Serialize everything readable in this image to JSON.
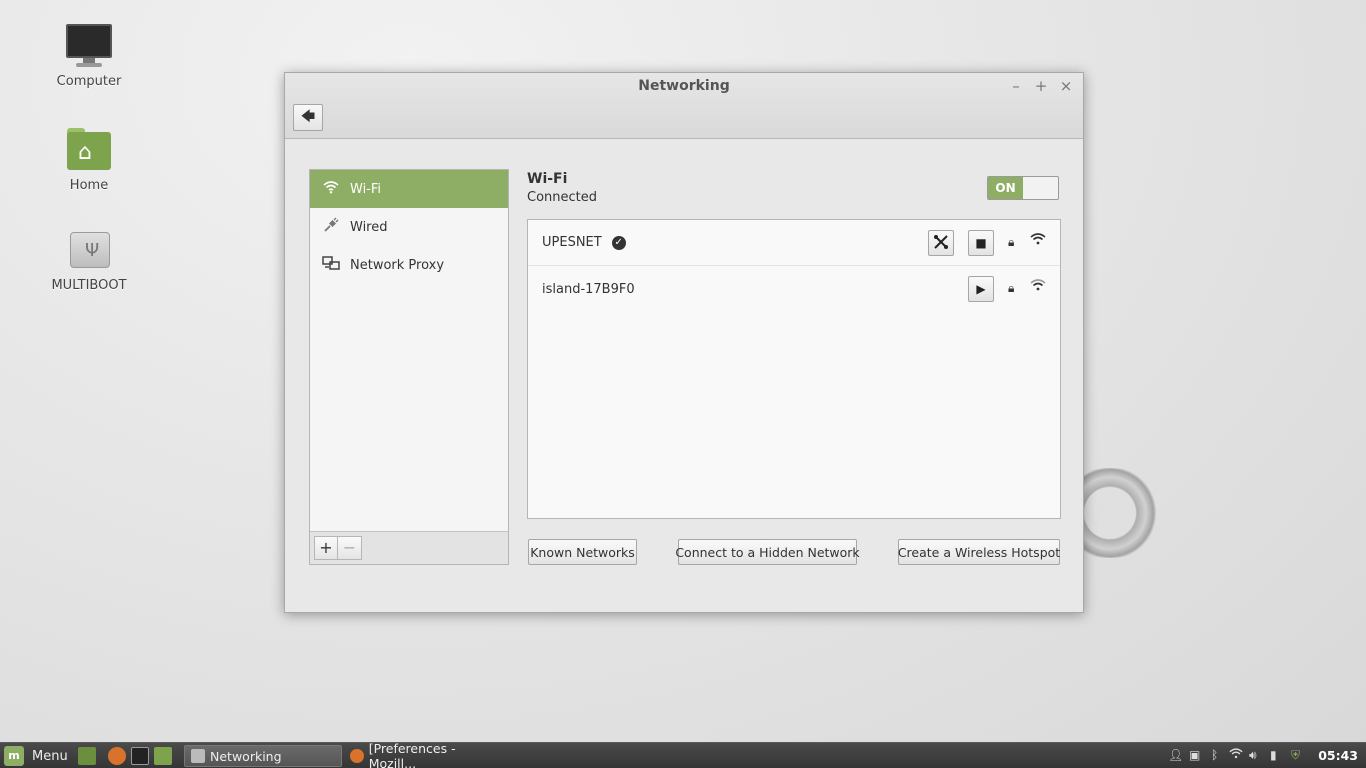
{
  "desktop": {
    "icons": [
      {
        "label": "Computer"
      },
      {
        "label": "Home"
      },
      {
        "label": "MULTIBOOT"
      }
    ]
  },
  "window": {
    "title": "Networking",
    "controls": {
      "minimize": "–",
      "maximize": "+",
      "close": "×"
    },
    "back_glyph": "🡄"
  },
  "sidebar": {
    "items": [
      {
        "label": "Wi-Fi",
        "icon": "wifi-icon",
        "active": true
      },
      {
        "label": "Wired",
        "icon": "wired-plug-icon",
        "active": false
      },
      {
        "label": "Network Proxy",
        "icon": "network-proxy-icon",
        "active": false
      }
    ],
    "add_label": "+",
    "remove_label": "−"
  },
  "wifi": {
    "title": "Wi-Fi",
    "status": "Connected",
    "toggle_label": "ON",
    "networks": [
      {
        "name": "UPESNET",
        "connected": true,
        "secured": true
      },
      {
        "name": "island-17B9F0",
        "connected": false,
        "secured": true
      }
    ]
  },
  "actions": {
    "known_networks": "Known Networks",
    "hidden_network": "Connect to a Hidden Network",
    "hotspot": "Create a Wireless Hotspot"
  },
  "taskbar": {
    "menu_label": "Menu",
    "tasks": [
      {
        "label": "Networking",
        "active": true
      },
      {
        "label": "[Preferences - Mozill...",
        "active": false
      }
    ],
    "clock": "05:43"
  },
  "colors": {
    "accent": "#8eae66",
    "taskbar": "#3b3b3b"
  }
}
